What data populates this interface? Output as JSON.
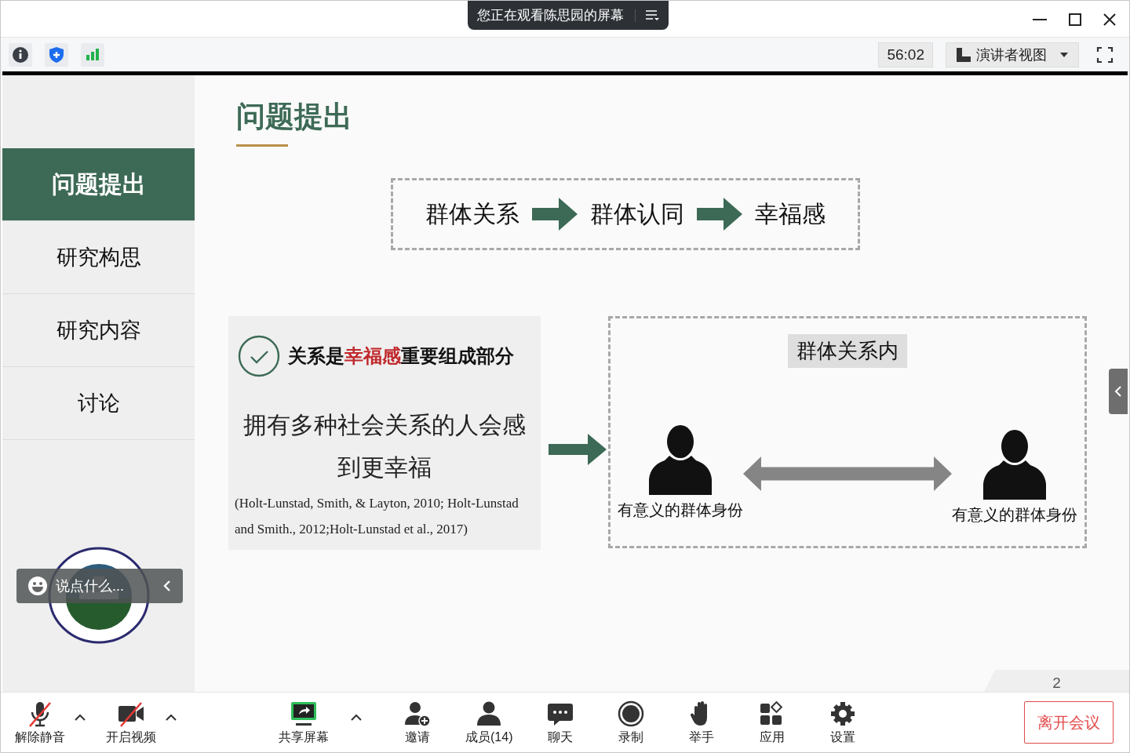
{
  "window": {
    "banner": "您正在观看陈思园的屏幕"
  },
  "toolbar": {
    "timer": "56:02",
    "view_menu": "演讲者视图"
  },
  "sidebar": {
    "items": [
      {
        "label": "问题提出",
        "selected": true
      },
      {
        "label": "研究构思",
        "selected": false
      },
      {
        "label": "研究内容",
        "selected": false
      },
      {
        "label": "讨论",
        "selected": false
      }
    ]
  },
  "chat_input": {
    "placeholder": "说点什么..."
  },
  "slide": {
    "title": "问题提出",
    "flow": [
      "群体关系",
      "群体认同",
      "幸福感"
    ],
    "finding": {
      "heading": [
        {
          "text": "关系是",
          "emphasis": false
        },
        {
          "text": "幸福感",
          "emphasis": true
        },
        {
          "text": "重要组成部分",
          "emphasis": false
        }
      ],
      "statement": "拥有多种社会关系的人会感到更幸福",
      "citation": "(Holt-Lunstad, Smith, & Layton, 2010; Holt-Lunstad and Smith., 2012;Holt-Lunstad et al., 2017)"
    },
    "relation": {
      "label": "群体关系内",
      "people": [
        "有意义的群体身份",
        "有意义的群体身份"
      ]
    },
    "page_number": "2"
  },
  "controls": [
    {
      "kind": "mic",
      "label": "解除静音",
      "on": false,
      "has_menu": true
    },
    {
      "kind": "video",
      "label": "开启视频",
      "on": false,
      "has_menu": true
    },
    {
      "kind": "share",
      "label": "共享屏幕",
      "has_menu": true
    },
    {
      "kind": "invite",
      "label": "邀请",
      "has_menu": false
    },
    {
      "kind": "members",
      "label": "成员(14)",
      "has_menu": false
    },
    {
      "kind": "chat",
      "label": "聊天",
      "has_menu": false
    },
    {
      "kind": "record",
      "label": "录制",
      "has_menu": false
    },
    {
      "kind": "raise",
      "label": "举手",
      "has_menu": false
    },
    {
      "kind": "apps",
      "label": "应用",
      "has_menu": false
    },
    {
      "kind": "settings",
      "label": "设置",
      "has_menu": false
    }
  ],
  "leave_button": "离开会议"
}
